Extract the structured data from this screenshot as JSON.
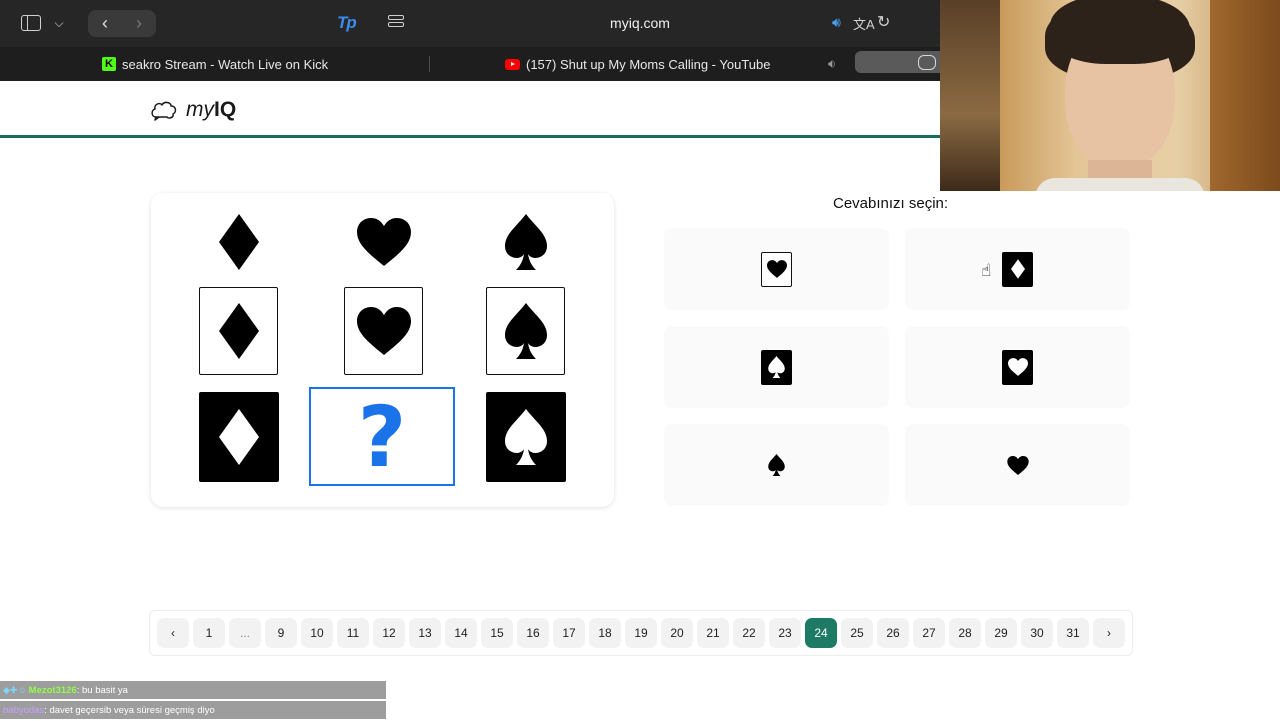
{
  "browser": {
    "url": "myiq.com",
    "tabs": [
      {
        "title": "seakro Stream - Watch Live on Kick"
      },
      {
        "title": "(157) Shut up My Moms Calling - YouTube"
      }
    ],
    "icons": {
      "sidebar": "sidebar-icon",
      "back": "chevron-left-icon",
      "forward": "chevron-right-icon",
      "extension": "tp-extension-icon",
      "reader": "reader-icon",
      "audio": "speaker-icon",
      "translate": "translate-icon",
      "reload": "reload-icon"
    },
    "colors": {
      "kick": "#53fc18",
      "youtube": "#ff0000",
      "audio_active": "#4aa3ff"
    }
  },
  "site": {
    "logo_text_my": "my",
    "logo_text_iq": "IQ",
    "header_rule_color": "#1d6b5a"
  },
  "puzzle": {
    "grid": [
      [
        {
          "suit": "diamond",
          "style": "plain"
        },
        {
          "suit": "heart",
          "style": "plain"
        },
        {
          "suit": "spade",
          "style": "plain"
        }
      ],
      [
        {
          "suit": "diamond",
          "style": "outlined"
        },
        {
          "suit": "heart",
          "style": "outlined"
        },
        {
          "suit": "spade",
          "style": "outlined"
        }
      ],
      [
        {
          "suit": "diamond",
          "style": "filled"
        },
        {
          "suit": "unknown",
          "style": "question",
          "label": "?"
        },
        {
          "suit": "spade",
          "style": "filled"
        }
      ]
    ],
    "question_color": "#1a73e8"
  },
  "answers": {
    "prompt": "Cevabınızı seçin:",
    "options": [
      {
        "suit": "heart",
        "style": "outlined"
      },
      {
        "suit": "diamond",
        "style": "filled"
      },
      {
        "suit": "spade",
        "style": "filled"
      },
      {
        "suit": "heart",
        "style": "filled"
      },
      {
        "suit": "spade",
        "style": "plain"
      },
      {
        "suit": "heart",
        "style": "plain"
      }
    ]
  },
  "pagination": {
    "prev_label": "‹",
    "next_label": "›",
    "pages": [
      "1",
      "...",
      "9",
      "10",
      "11",
      "12",
      "13",
      "14",
      "15",
      "16",
      "17",
      "18",
      "19",
      "20",
      "21",
      "22",
      "23",
      "24",
      "25",
      "26",
      "27",
      "28",
      "29",
      "30",
      "31"
    ],
    "current": "24",
    "accent": "#1d7a64"
  },
  "chat": [
    {
      "user": "Mezot3126",
      "message": ": bu basit ya"
    },
    {
      "user": "babyodas",
      "message": ": davet geçersib veya süresi geçmiş diyo"
    }
  ]
}
